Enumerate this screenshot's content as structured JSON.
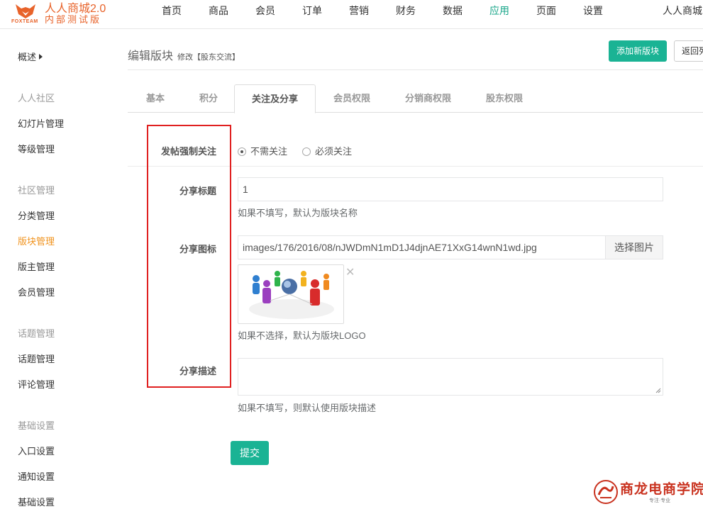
{
  "brand": {
    "logo_sub": "FOXTEAM",
    "title": "人人商城2.0",
    "subtitle": "内部测试版",
    "color": "#e8632a"
  },
  "nav": {
    "items": [
      "首页",
      "商品",
      "会员",
      "订单",
      "营销",
      "财务",
      "数据",
      "应用",
      "页面",
      "设置"
    ],
    "active": "应用",
    "right_text": "人人商城"
  },
  "sidebar": {
    "overview": "概述",
    "groups": [
      {
        "title": "人人社区",
        "items": [
          "幻灯片管理",
          "等级管理"
        ]
      },
      {
        "title": "社区管理",
        "items": [
          "分类管理",
          "版块管理",
          "版主管理",
          "会员管理"
        ]
      },
      {
        "title": "话题管理",
        "items": [
          "话题管理",
          "评论管理"
        ]
      },
      {
        "title": "基础设置",
        "items": [
          "入口设置",
          "通知设置",
          "基础设置"
        ]
      }
    ],
    "active_item": "版块管理"
  },
  "header": {
    "title": "编辑版块",
    "subtitle": "修改【股东交流】",
    "add_button": "添加新版块",
    "back_button": "返回列表"
  },
  "tabs": {
    "items": [
      "基本",
      "积分",
      "关注及分享",
      "会员权限",
      "分销商权限",
      "股东权限"
    ],
    "active": "关注及分享"
  },
  "form": {
    "force_follow": {
      "label": "发帖强制关注",
      "options": [
        "不需关注",
        "必须关注"
      ],
      "selected": "不需关注"
    },
    "share_title": {
      "label": "分享标题",
      "value": "1",
      "help": "如果不填写，默认为版块名称"
    },
    "share_icon": {
      "label": "分享图标",
      "value": "images/176/2016/08/nJWDmN1mD1J4djnAE71XxG14wnN1wd.jpg",
      "pick_button": "选择图片",
      "remove_icon": "close-icon",
      "help": "如果不选择，默认为版块LOGO"
    },
    "share_desc": {
      "label": "分享描述",
      "value": "",
      "help": "如果不填写，则默认使用版块描述"
    },
    "submit": "提交"
  },
  "watermark": {
    "title": "商龙电商学院",
    "sub": "专注·专业"
  },
  "colors": {
    "accent": "#1ab394",
    "active_sidebar": "#f0931e",
    "highlight_box": "#e02020"
  }
}
